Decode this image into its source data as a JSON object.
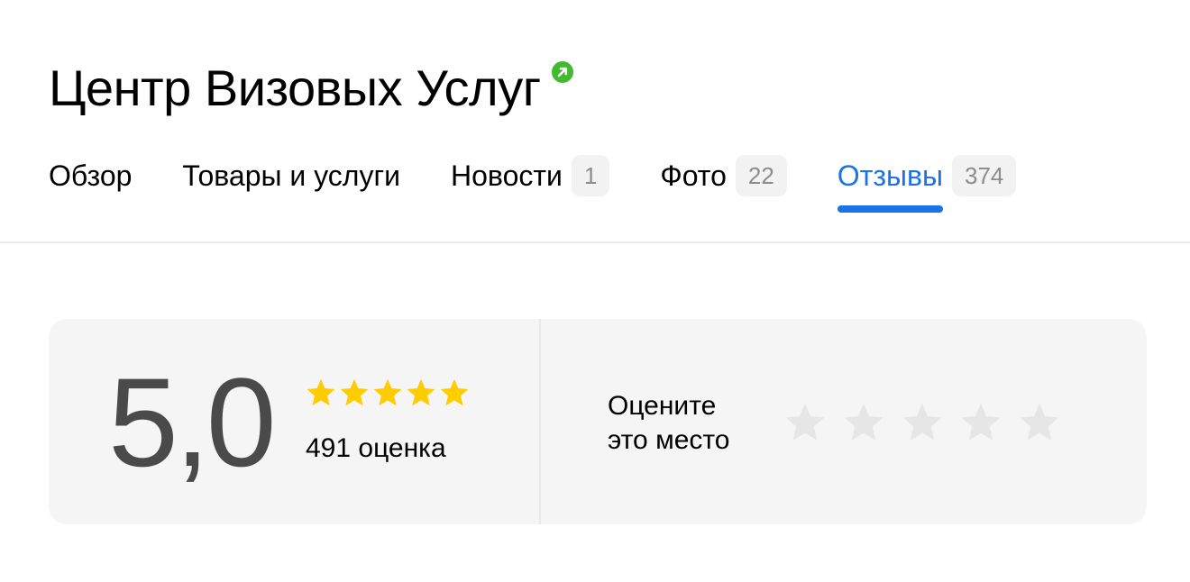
{
  "organization": {
    "name": "Центр Визовых Услуг",
    "badge_icon": "verified-arrow-icon"
  },
  "tabs": [
    {
      "label": "Обзор",
      "count": null,
      "active": false
    },
    {
      "label": "Товары и услуги",
      "count": null,
      "active": false
    },
    {
      "label": "Новости",
      "count": "1",
      "active": false
    },
    {
      "label": "Фото",
      "count": "22",
      "active": false
    },
    {
      "label": "Отзывы",
      "count": "374",
      "active": true
    }
  ],
  "rating": {
    "value": "5,0",
    "stars_filled": 5,
    "stars_total": 5,
    "count_text": "491 оценка"
  },
  "rate_place": {
    "prompt_line1": "Оцените",
    "prompt_line2": "это место",
    "stars_total": 5
  },
  "colors": {
    "accent": "#1a73e8",
    "star_filled": "#ffcc00",
    "star_empty": "#e6e6e6",
    "verified_green": "#3fbb2d"
  }
}
